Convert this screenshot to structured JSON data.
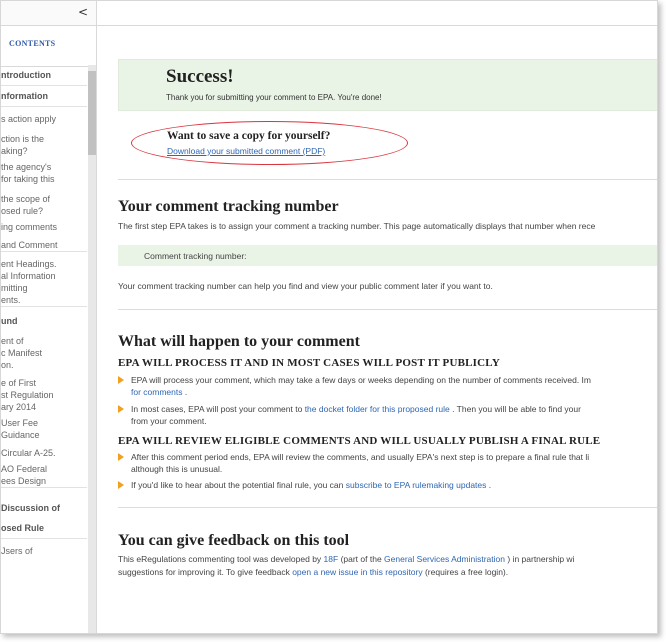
{
  "sidebar": {
    "collapse_glyph": "<",
    "contents_label": "CONTENTS",
    "items": [
      {
        "text": "ntroduction",
        "bold": true
      },
      {
        "text": "nformation",
        "bold": true
      },
      {
        "text": "s action apply",
        "bold": false
      },
      {
        "text": "ction is the",
        "bold": false
      },
      {
        "text": "aking?",
        "bold": false
      },
      {
        "text": " the agency's",
        "bold": false
      },
      {
        "text": " for taking this",
        "bold": false
      },
      {
        "text": " the scope of",
        "bold": false
      },
      {
        "text": "osed rule?",
        "bold": false
      },
      {
        "text": "ing comments",
        "bold": false
      },
      {
        "text": " and Comment",
        "bold": false
      },
      {
        "text": "ent Headings.",
        "bold": false
      },
      {
        "text": "al Information",
        "bold": false
      },
      {
        "text": "mitting",
        "bold": false
      },
      {
        "text": "ents.",
        "bold": false
      },
      {
        "text": "und",
        "bold": true
      },
      {
        "text": "ent of",
        "bold": false
      },
      {
        "text": "c Manifest",
        "bold": false
      },
      {
        "text": "on.",
        "bold": false
      },
      {
        "text": "e of First",
        "bold": false
      },
      {
        "text": "st Regulation",
        "bold": false
      },
      {
        "text": "ary 2014",
        "bold": false
      },
      {
        "text": " User Fee",
        "bold": false
      },
      {
        "text": "Guidance",
        "bold": false
      },
      {
        "text": "Circular A-25.",
        "bold": false
      },
      {
        "text": "AO Federal",
        "bold": false
      },
      {
        "text": "ees Design",
        "bold": false
      },
      {
        "text": " Discussion of",
        "bold": true
      },
      {
        "text": "osed Rule",
        "bold": true
      },
      {
        "text": "Jsers of",
        "bold": false
      }
    ]
  },
  "success": {
    "title": "Success!",
    "message": "Thank you for submitting your comment to EPA. You're done!"
  },
  "save_copy": {
    "title": "Want to save a copy for yourself?",
    "link": "Download your submitted comment (PDF)"
  },
  "tracking": {
    "heading": "Your comment tracking number",
    "intro": "The first step EPA takes is to assign your comment a tracking number. This page automatically displays that number when rece",
    "label": "Comment tracking number:",
    "note": "Your comment tracking number can help you find and view your public comment later if you want to."
  },
  "happen": {
    "heading": "What will happen to your comment",
    "sub1": "EPA WILL PROCESS IT AND IN MOST CASES WILL POST IT PUBLICLY",
    "b1_line1": "EPA will process your comment, which may take a few days or weeks depending on the number of comments received. Im",
    "b1_line2_link": "for comments",
    "b1_line2_after": "  .",
    "b2_before": "In most cases, EPA will post your comment to ",
    "b2_link": "the docket folder for this proposed rule",
    "b2_after": "   . Then you will be able to find your",
    "b2_line2": "from your comment.",
    "sub2": "EPA WILL REVIEW ELIGIBLE COMMENTS AND WILL USUALLY PUBLISH A FINAL RULE",
    "b3_line1": "After this comment period ends, EPA will review the comments, and usually EPA's next step is to prepare a final rule that li",
    "b3_line2": "although this is unusual.",
    "b4_before": "If you'd like to hear about the potential final rule, you can ",
    "b4_link": "subscribe to EPA rulemaking updates",
    "b4_after": "   ."
  },
  "feedback": {
    "heading": "You can give feedback on this tool",
    "l1_a": "This eRegulations commenting tool was developed by ",
    "l1_link1": "18F",
    "l1_b": "   (part of the ",
    "l1_link2": "General Services Administration",
    "l1_c": "   ) in partnership wi",
    "l2_a": "suggestions for improving it. To give feedback ",
    "l2_link": "open a new issue in this repository",
    "l2_b": "   (requires a free login)."
  },
  "colors": {
    "accent_link": "#2f66b3",
    "success_bg": "#eaf4e6",
    "bullet_arrow": "#f0a022",
    "highlight_oval": "#d9363e"
  }
}
